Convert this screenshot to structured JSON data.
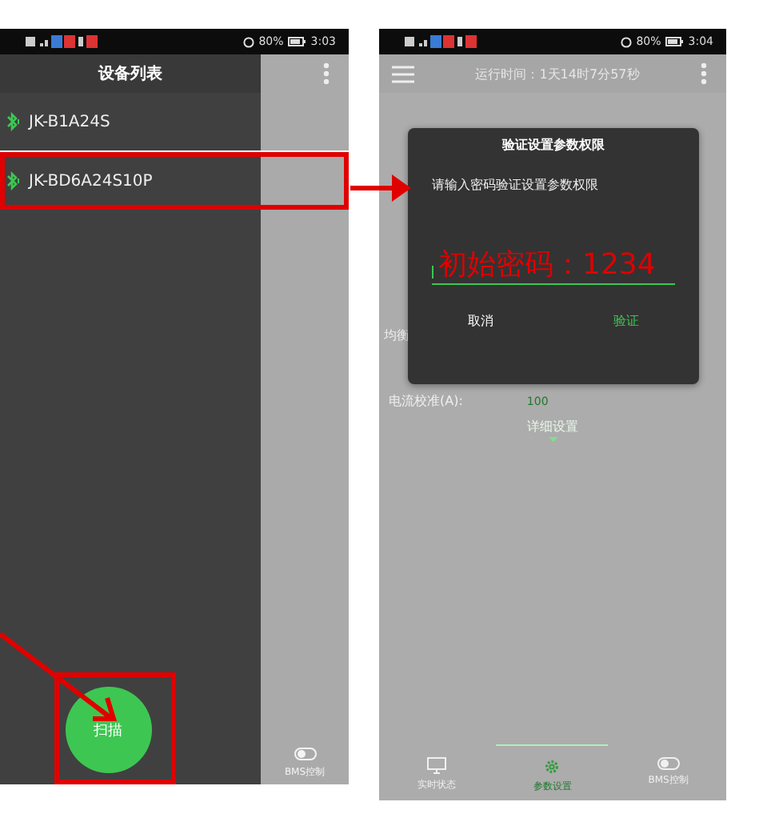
{
  "left_phone": {
    "status_bar": {
      "battery": "80%",
      "time": "3:03"
    },
    "drawer": {
      "title": "设备列表",
      "devices": [
        {
          "name": "JK-B1A24S",
          "highlighted": false
        },
        {
          "name": "JK-BD6A24S10P",
          "highlighted": true
        }
      ]
    },
    "scan_button": {
      "label": "扫描",
      "highlighted": true
    },
    "nav_peek": {
      "label": "BMS控制"
    }
  },
  "right_phone": {
    "status_bar": {
      "battery": "80%",
      "time": "3:04"
    },
    "header": {
      "title": "运行时间：1天14时7分57秒"
    },
    "fields": [
      {
        "label": "均衡"
      },
      {
        "label": "电流校准(A):",
        "value": "100"
      }
    ],
    "details_link": "详细设置",
    "dialog": {
      "title": "验证设置参数权限",
      "message": "请输入密码验证设置参数权限",
      "annotation": "初始密码：1234",
      "buttons": [
        {
          "label": "取消",
          "kind": "cancel"
        },
        {
          "label": "验证",
          "kind": "confirm"
        }
      ]
    },
    "bottom_nav": [
      {
        "label": "实时状态",
        "kind": "monitor",
        "selected": false
      },
      {
        "label": "参数设置",
        "kind": "gear",
        "selected": true
      },
      {
        "label": "BMS控制",
        "kind": "toggle",
        "selected": false
      }
    ]
  }
}
